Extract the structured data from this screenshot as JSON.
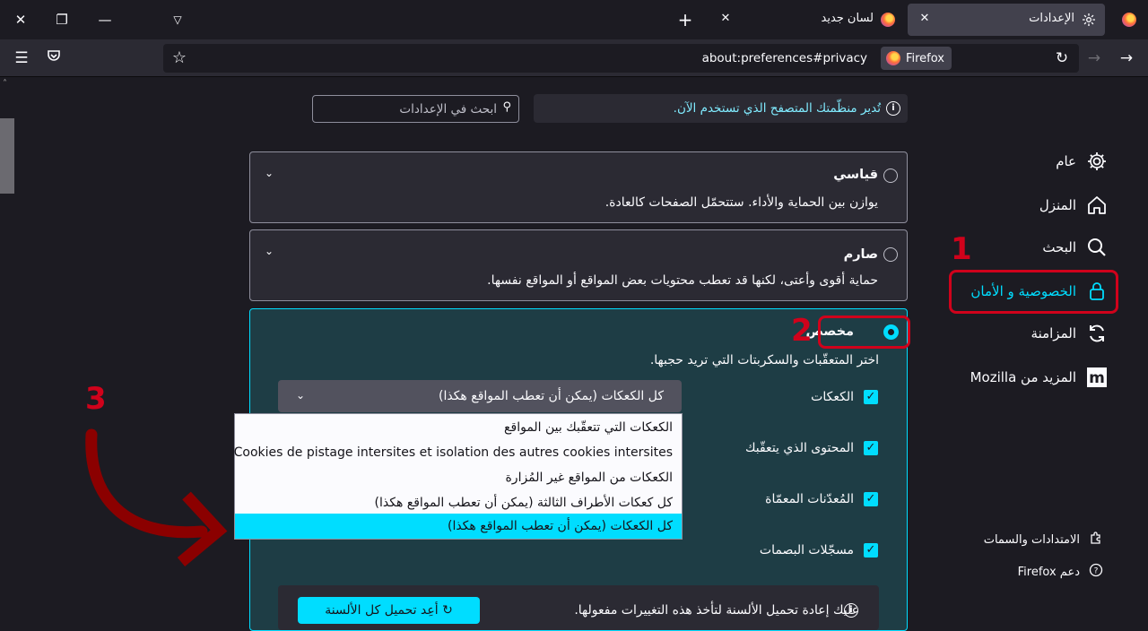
{
  "tabs": [
    {
      "label": "الإعدادات",
      "active": true
    },
    {
      "label": "لسان جديد",
      "active": false
    }
  ],
  "address": {
    "url": "about:preferences#privacy",
    "identity": "Firefox"
  },
  "sidebar": {
    "items": [
      {
        "label": "عام",
        "icon": "gear-icon"
      },
      {
        "label": "المنزل",
        "icon": "home-icon"
      },
      {
        "label": "البحث",
        "icon": "search-icon"
      },
      {
        "label": "الخصوصية و الأمان",
        "icon": "lock-icon",
        "selected": true
      },
      {
        "label": "المزامنة",
        "icon": "sync-icon"
      },
      {
        "label": "المزيد من Mozilla",
        "icon": "mozilla-icon"
      }
    ],
    "footer": [
      {
        "label": "الامتدادات والسمات",
        "icon": "puzzle-icon"
      },
      {
        "label": "دعم Firefox",
        "icon": "help-icon"
      }
    ]
  },
  "notice": {
    "text": "تُدير منظّمتك المتصفح الذي تستخدم الآن."
  },
  "search": {
    "placeholder": "ابحث في الإعدادات"
  },
  "protection": {
    "standard": {
      "title": "قياسي",
      "desc": "يوازن بين الحماية والأداء. ستتحمّل الصفحات كالعادة."
    },
    "strict": {
      "title": "صارم",
      "desc": "حماية أقوى وأعتى، لكنها قد تعطب محتويات بعض المواقع أو المواقع نفسها."
    },
    "custom": {
      "title": "مخصص",
      "desc": "اختر المتعقّبات والسكربتات التي تريد حجبها.",
      "cookies_label": "الكعكات",
      "tracking_label": "المحتوى الذي يتعقّبك",
      "crypto_label": "المُعدّنات المعمّاة",
      "finger_label": "مسجّلات البصمات",
      "cookies_value": "كل الكعكات (يمكن أن تعطب المواقع هكذا)"
    }
  },
  "dropdown": {
    "options": [
      "الكعكات التي تتعقّبك بين المواقع",
      "Cookies de pistage intersites et isolation des autres cookies intersites",
      "الكعكات من المواقع غير المُزارة",
      "كل كعكات الأطراف الثالثة (يمكن أن تعطب المواقع هكذا)",
      "كل الكعكات (يمكن أن تعطب المواقع هكذا)"
    ],
    "selected_index": 4
  },
  "reload": {
    "message": "عليك إعادة تحميل الألسنة لتأخذ هذه التغييرات مفعولها.",
    "button": "أعِد تحميل كل الألسنة"
  },
  "annotations": {
    "n1": "1",
    "n2": "2",
    "n3": "3"
  },
  "colors": {
    "accent": "#00ddff",
    "annotation": "#d0021b"
  }
}
